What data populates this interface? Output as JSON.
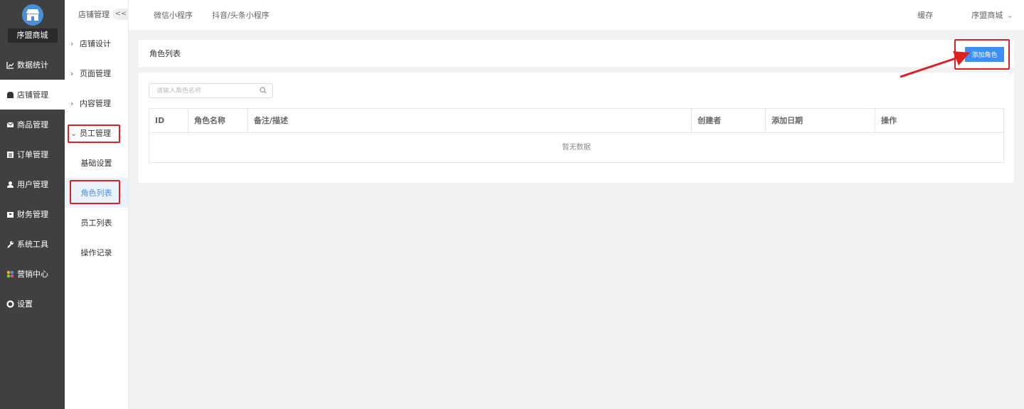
{
  "sidebar": {
    "shop_name": "序盟商城",
    "items": [
      {
        "label": "数据统计",
        "icon": "chart-line-icon"
      },
      {
        "label": "店铺管理",
        "icon": "store-icon"
      },
      {
        "label": "商品管理",
        "icon": "mail-icon"
      },
      {
        "label": "订单管理",
        "icon": "list-icon"
      },
      {
        "label": "用户管理",
        "icon": "user-icon"
      },
      {
        "label": "财务管理",
        "icon": "wallet-icon"
      },
      {
        "label": "系统工具",
        "icon": "wrench-icon"
      },
      {
        "label": "营销中心",
        "icon": "marketing-icon"
      },
      {
        "label": "设置",
        "icon": "gear-icon"
      }
    ]
  },
  "subsidebar": {
    "heading": "店铺管理",
    "collapse": "<<",
    "groups": [
      {
        "label": "店铺设计"
      },
      {
        "label": "页面管理"
      },
      {
        "label": "内容管理"
      },
      {
        "label": "员工管理"
      }
    ],
    "subitems": [
      {
        "label": "基础设置"
      },
      {
        "label": "角色列表"
      },
      {
        "label": "员工列表"
      },
      {
        "label": "操作记录"
      }
    ]
  },
  "topbar": {
    "tabs": [
      "微信小程序",
      "抖音/头条小程序"
    ],
    "cache": "缓存",
    "account": "序盟商城"
  },
  "page": {
    "title": "角色列表",
    "add_button": "添加角色",
    "search_placeholder": "请输入角色名称",
    "columns": [
      "ID",
      "角色名称",
      "备注/描述",
      "创建者",
      "添加日期",
      "操作"
    ],
    "empty_text": "暂无数据"
  },
  "colors": {
    "accent": "#3e8ef7",
    "annotation": "#e02020"
  }
}
